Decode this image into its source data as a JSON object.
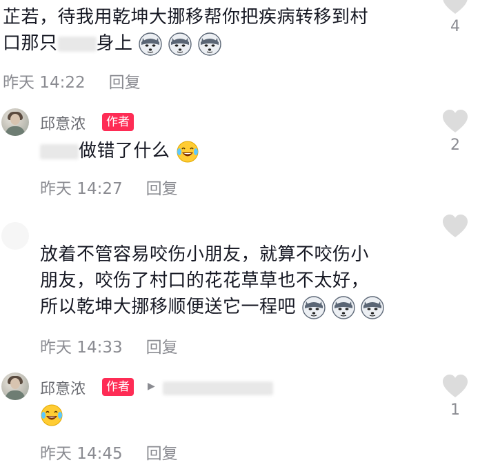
{
  "comments": [
    {
      "text_line1": "芷若，待我用乾坤大挪移帮你把疾病转移到村",
      "text_line2_prefix": "口那只",
      "text_line2_suffix": "身上",
      "time": "昨天 14:22",
      "reply_label": "回复",
      "like_count": "4"
    },
    {
      "author": "邱意浓",
      "badge": "作者",
      "text": "做错了什么",
      "time": "昨天 14:27",
      "reply_label": "回复",
      "like_count": "2"
    },
    {
      "text_line1": "放着不管容易咬伤小朋友，就算不咬伤小",
      "text_line2": "朋友，咬伤了村口的花花草草也不太好，",
      "text_line3": "所以乾坤大挪移顺便送它一程吧",
      "time": "昨天 14:33",
      "reply_label": "回复"
    },
    {
      "author": "邱意浓",
      "badge": "作者",
      "time": "昨天 14:45",
      "reply_label": "回复",
      "like_count": "1"
    }
  ],
  "icons": {
    "like": "heart-icon",
    "doge": "doge-emoji",
    "laugh": "laugh-cry-emoji",
    "reply_arrow": "triangle-right-icon"
  },
  "colors": {
    "badge": "#fe2c55",
    "meta": "#8a8b91",
    "heart": "#d9d9d9"
  }
}
